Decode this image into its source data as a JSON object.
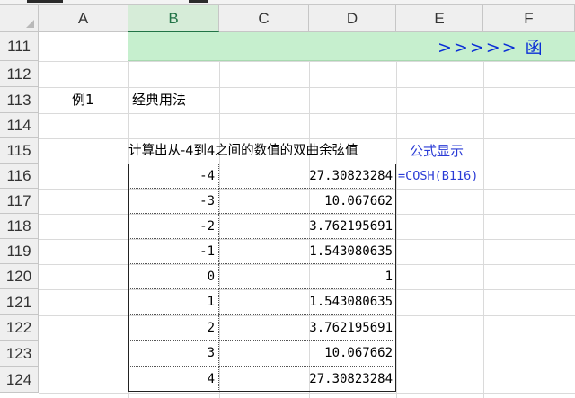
{
  "columns": [
    "A",
    "B",
    "C",
    "D",
    "E",
    "F"
  ],
  "selected_column": "B",
  "rows": [
    "111",
    "112",
    "113",
    "114",
    "115",
    "116",
    "117",
    "118",
    "119",
    "120",
    "121",
    "122",
    "123",
    "124"
  ],
  "banner": {
    "text": ">>>>>  函"
  },
  "example": {
    "label": "例1",
    "title": "经典用法"
  },
  "caption": "计算出从-4到4之间的数值的双曲余弦值",
  "formula_header": "公式显示",
  "formula": "=COSH(B116)",
  "table": {
    "rows": [
      {
        "x": "-4",
        "cosh": "27.30823284"
      },
      {
        "x": "-3",
        "cosh": "10.067662"
      },
      {
        "x": "-2",
        "cosh": "3.762195691"
      },
      {
        "x": "-1",
        "cosh": "1.543080635"
      },
      {
        "x": "0",
        "cosh": "1"
      },
      {
        "x": "1",
        "cosh": "1.543080635"
      },
      {
        "x": "2",
        "cosh": "3.762195691"
      },
      {
        "x": "3",
        "cosh": "10.067662"
      },
      {
        "x": "4",
        "cosh": "27.30823284"
      }
    ]
  },
  "colors": {
    "selected_header_bg": "#d6ecd8",
    "banner_bg": "#c6efce",
    "banner_text": "#0a2ed6",
    "formula_text": "#2a3bd6"
  }
}
